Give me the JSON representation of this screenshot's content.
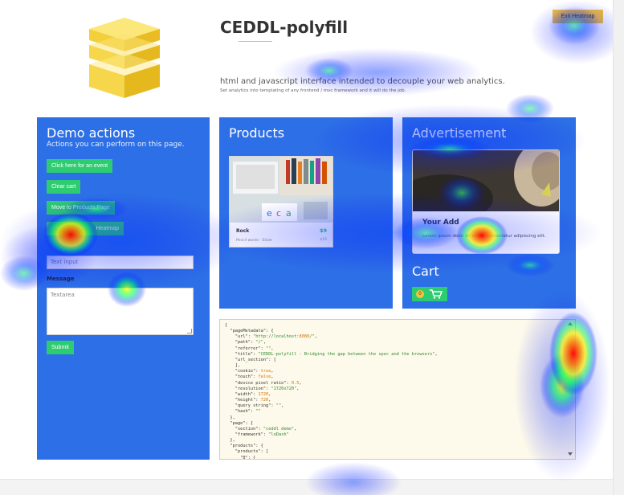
{
  "header": {
    "title": "CEDDL-polyfill",
    "tagline": "html and javascript interface intended to decouple your web analytics.",
    "subtagline": "Set analytics into templating of any frontend / mvc framework and it will do the job.",
    "exit_heatmap_label": "Exit Heatmap"
  },
  "demo": {
    "title": "Demo actions",
    "subtitle": "Actions you can perform on this page.",
    "buttons": {
      "event": "Click here for an event",
      "clear_cart": "Clear cart",
      "move_products": "Move to Products Page",
      "heatmap": "Heatmap"
    },
    "text_input_placeholder": "Text input",
    "message_label": "Message",
    "textarea_placeholder": "Textarea",
    "submit_label": "Submit"
  },
  "products": {
    "title": "Products",
    "items": [
      {
        "name": "Rock",
        "meta": "Pencil words - Silver",
        "price": "$9",
        "old_price": "$16"
      }
    ]
  },
  "ad": {
    "title": "Advertisement",
    "card_title": "Your Add",
    "card_text": "Lorem ipsum dolor sit amet, consectetur adipiscing elit."
  },
  "cart": {
    "title": "Cart",
    "count": "0",
    "icon": "cart-icon"
  },
  "json_viewer": {
    "lines": [
      "{",
      "  \"pageMetadata\": {",
      "    \"url\": \"http://localhost:8080/\",",
      "    \"path\": \"/\",",
      "    \"referrer\": \"\",",
      "    \"title\": \"CEDDL-polyfill - Bridging the gap between the spec and the browsers\",",
      "    \"url_section\": [",
      "    ],",
      "    \"cookie\": true,",
      "    \"touch\": false,",
      "    \"device pixel ratio\": 0.5,",
      "    \"resolution\": \"1720x720\",",
      "    \"width\": 1720,",
      "    \"height\": 720,",
      "    \"query string\": \"\",",
      "    \"hash\": \"\"",
      "  },",
      "  \"page\": {",
      "    \"section\": \"ceddl demo\",",
      "    \"framework\": \"loDash\"",
      "  },",
      "  \"products\": {",
      "    \"products\": [",
      "      \"0\": {"
    ]
  },
  "colors": {
    "panel": "#2d6fe6",
    "green": "#2ecc71",
    "yellow": "#f5c23a"
  }
}
